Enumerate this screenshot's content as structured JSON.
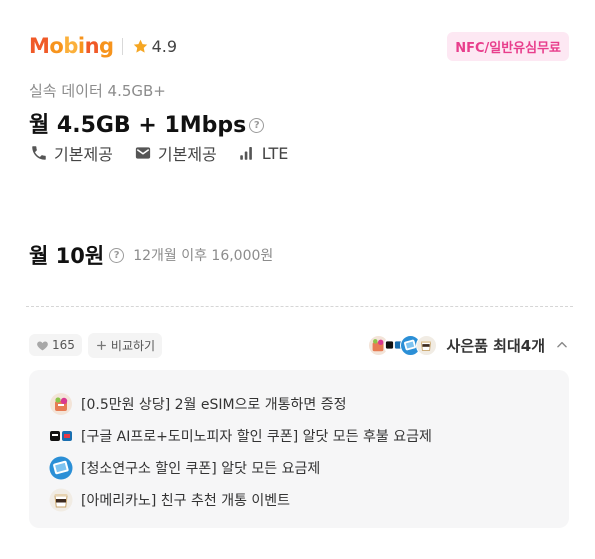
{
  "header": {
    "logo": [
      "M",
      "o",
      "b",
      "i",
      "n",
      "g"
    ],
    "rating": "4.9",
    "badge": "NFC/일반유심무료"
  },
  "plan": {
    "subtitle": "실속 데이터 4.5GB+",
    "title": "월 4.5GB + 1Mbps",
    "help_glyph": "?",
    "features": [
      {
        "icon": "phone-icon",
        "label": "기본제공"
      },
      {
        "icon": "mail-icon",
        "label": "기본제공"
      },
      {
        "icon": "signal-icon",
        "label": "LTE"
      }
    ]
  },
  "price": {
    "main": "월 10원",
    "sub": "12개월 이후 16,000원"
  },
  "actions": {
    "likes": "165",
    "compare": "비교하기",
    "gift_label": "사은품 최대4개"
  },
  "gifts": [
    {
      "icon": "gift-bag-icon",
      "label": "[0.5만원 상당] 2월 eSIM으로 개통하면 증정"
    },
    {
      "icon": "coupon-pair-icon",
      "label": "[구글 AI프로+도미노피자 할인 쿠폰] 알닷 모든 후불 요금제"
    },
    {
      "icon": "tablet-icon",
      "label": "[청소연구소 할인 쿠폰] 알닷 모든 요금제"
    },
    {
      "icon": "coffee-icon",
      "label": "[아메리카노] 친구 추천 개통 이벤트"
    }
  ],
  "colors": {
    "brand_orange": "#f05a28",
    "badge_bg": "#fde8f3",
    "badge_text": "#e83e8c",
    "star": "#f5a623"
  }
}
